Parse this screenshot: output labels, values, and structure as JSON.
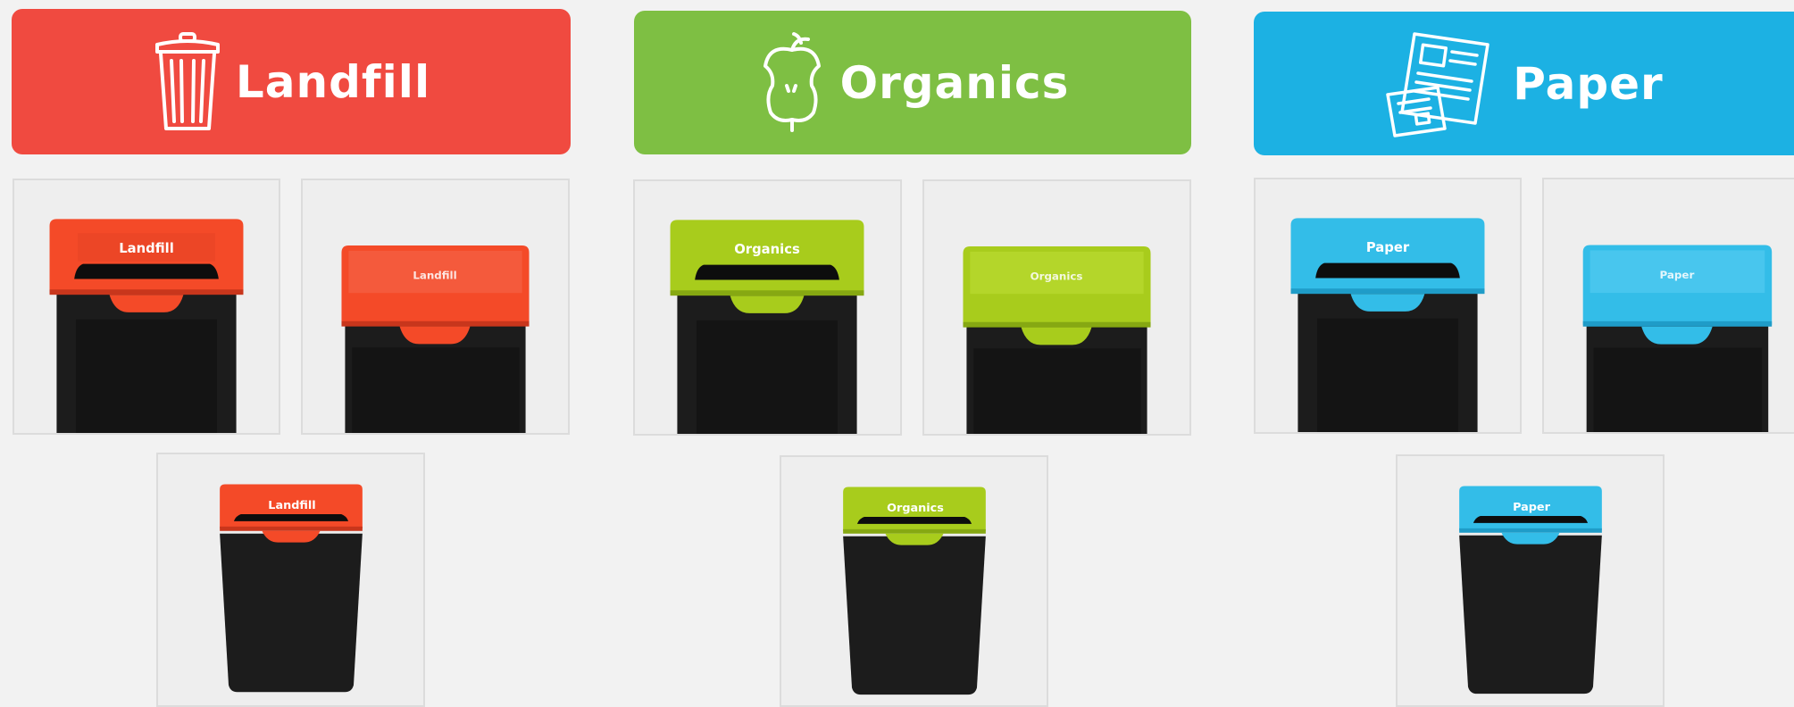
{
  "categories": [
    {
      "key": "landfill",
      "label": "Landfill",
      "icon": "trash-bin-icon",
      "color": "#f04a40",
      "lid_color": "#f44a28",
      "lid_dark": "#c8361c"
    },
    {
      "key": "organics",
      "label": "Organics",
      "icon": "apple-core-icon",
      "color": "#7ebf43",
      "lid_color": "#a8cc1c",
      "lid_dark": "#86a812"
    },
    {
      "key": "paper",
      "label": "Paper",
      "icon": "newspaper-icon",
      "color": "#1cb1e3",
      "lid_color": "#33bde8",
      "lid_dark": "#1f9cc8"
    }
  ],
  "bin_body_color": "#1c1c1c"
}
